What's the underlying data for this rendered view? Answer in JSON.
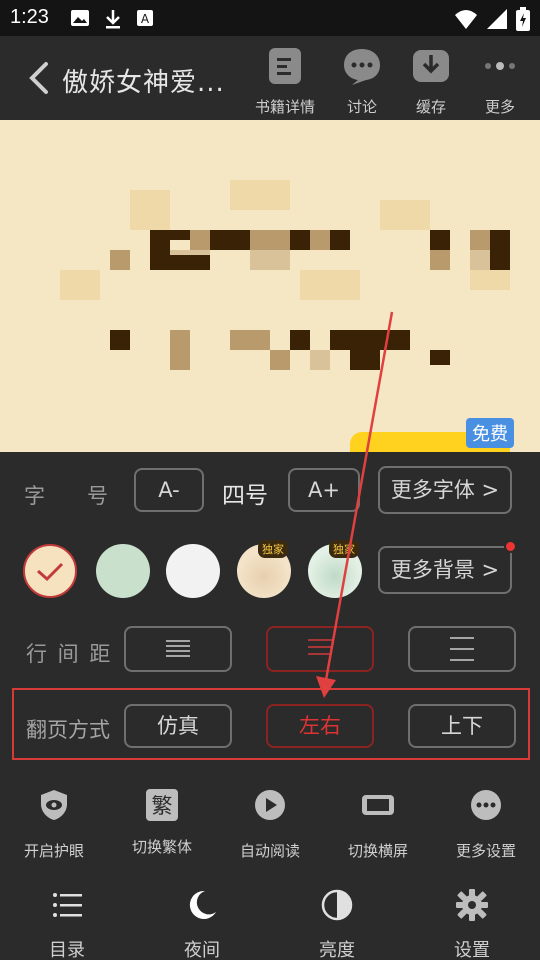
{
  "status_bar": {
    "time": "1:23",
    "icons_left": [
      "image-icon",
      "download-icon",
      "a-icon"
    ],
    "icons_right": [
      "wifi-icon",
      "signal-icon",
      "battery-icon"
    ]
  },
  "header": {
    "book_title": "傲娇女神爱...",
    "actions": [
      {
        "icon": "book-details-icon",
        "label": "书籍详情"
      },
      {
        "icon": "discuss-icon",
        "label": "讨论"
      },
      {
        "icon": "cache-icon",
        "label": "缓存"
      },
      {
        "icon": "more-icon",
        "label": "更多"
      }
    ]
  },
  "reading": {
    "free_badge": "免费"
  },
  "font_size": {
    "label": "字　　号",
    "decrease": "A-",
    "value": "四号",
    "increase": "A+",
    "more_fonts": "更多字体 >"
  },
  "background": {
    "swatches": [
      {
        "name": "beige",
        "color": "#f7e2c0",
        "selected": true
      },
      {
        "name": "green",
        "color": "#c9e0cc",
        "selected": false
      },
      {
        "name": "white",
        "color": "#f2f2f2",
        "selected": false
      },
      {
        "name": "paper",
        "color": "#f1dcc0",
        "tag": "独家"
      },
      {
        "name": "mint",
        "color": "#dcecdf",
        "tag": "独家"
      }
    ],
    "more_bg": "更多背景 >",
    "accent_color": "#d33b3b"
  },
  "line_spacing": {
    "label": "行 间 距",
    "options": [
      "tight",
      "medium",
      "loose"
    ],
    "selected": "medium"
  },
  "page_flip": {
    "label": "翻页方式",
    "options": [
      "仿真",
      "左右",
      "上下"
    ],
    "selected": "左右"
  },
  "tools": [
    {
      "icon": "eye-protect-icon",
      "label": "开启护眼"
    },
    {
      "icon": "traditional-icon",
      "label": "切换繁体",
      "glyph": "繁"
    },
    {
      "icon": "auto-read-icon",
      "label": "自动阅读"
    },
    {
      "icon": "landscape-icon",
      "label": "切换横屏"
    },
    {
      "icon": "more-settings-icon",
      "label": "更多设置"
    }
  ],
  "nav": [
    {
      "icon": "toc-icon",
      "label": "目录"
    },
    {
      "icon": "night-icon",
      "label": "夜间"
    },
    {
      "icon": "brightness-icon",
      "label": "亮度"
    },
    {
      "icon": "settings-icon",
      "label": "设置"
    }
  ]
}
